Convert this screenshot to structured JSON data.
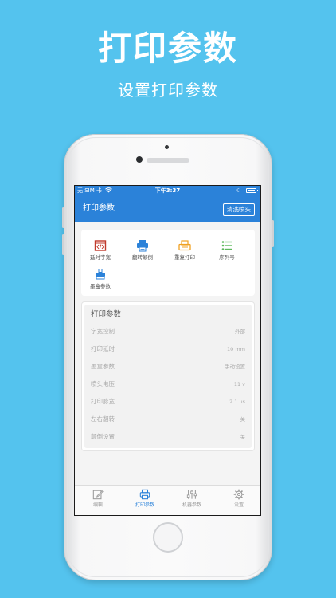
{
  "promo": {
    "title": "打印参数",
    "subtitle": "设置打印参数"
  },
  "statusbar": {
    "carrier": "无 SIM 卡",
    "time": "下午3:37"
  },
  "nav": {
    "title": "打印参数",
    "clean_button": "清洗喷头"
  },
  "functions": [
    {
      "label": "延时字宽",
      "icon": "code-box-icon",
      "color": "#c0392b"
    },
    {
      "label": "翻转颠倒",
      "icon": "printer-flip-icon",
      "color": "#2b82d9"
    },
    {
      "label": "重复打印",
      "icon": "repeat-print-icon",
      "color": "#f0a020"
    },
    {
      "label": "序列号",
      "icon": "list-icon",
      "color": "#5cb85c"
    },
    {
      "label": "墨盒参数",
      "icon": "cartridge-icon",
      "color": "#2b82d9"
    }
  ],
  "params": {
    "title": "打印参数",
    "rows": [
      {
        "name": "字宽控制",
        "value": "外部"
      },
      {
        "name": "打印延时",
        "value": "10 mm"
      },
      {
        "name": "墨盒参数",
        "value": "手动设置"
      },
      {
        "name": "喷头电压",
        "value": "11 v"
      },
      {
        "name": "打印脉宽",
        "value": "2.1 us"
      },
      {
        "name": "左右翻转",
        "value": "关"
      },
      {
        "name": "颠倒设置",
        "value": "关"
      }
    ]
  },
  "tabs": [
    {
      "label": "编辑",
      "icon": "edit-icon",
      "active": false
    },
    {
      "label": "打印参数",
      "icon": "printer-icon",
      "active": true
    },
    {
      "label": "机器参数",
      "icon": "sliders-icon",
      "active": false
    },
    {
      "label": "设置",
      "icon": "gear-icon",
      "active": false
    }
  ],
  "colors": {
    "background": "#54c3ee",
    "nav": "#2b82d9",
    "tab_active": "#2b82d9",
    "tab_inactive": "#999999"
  }
}
